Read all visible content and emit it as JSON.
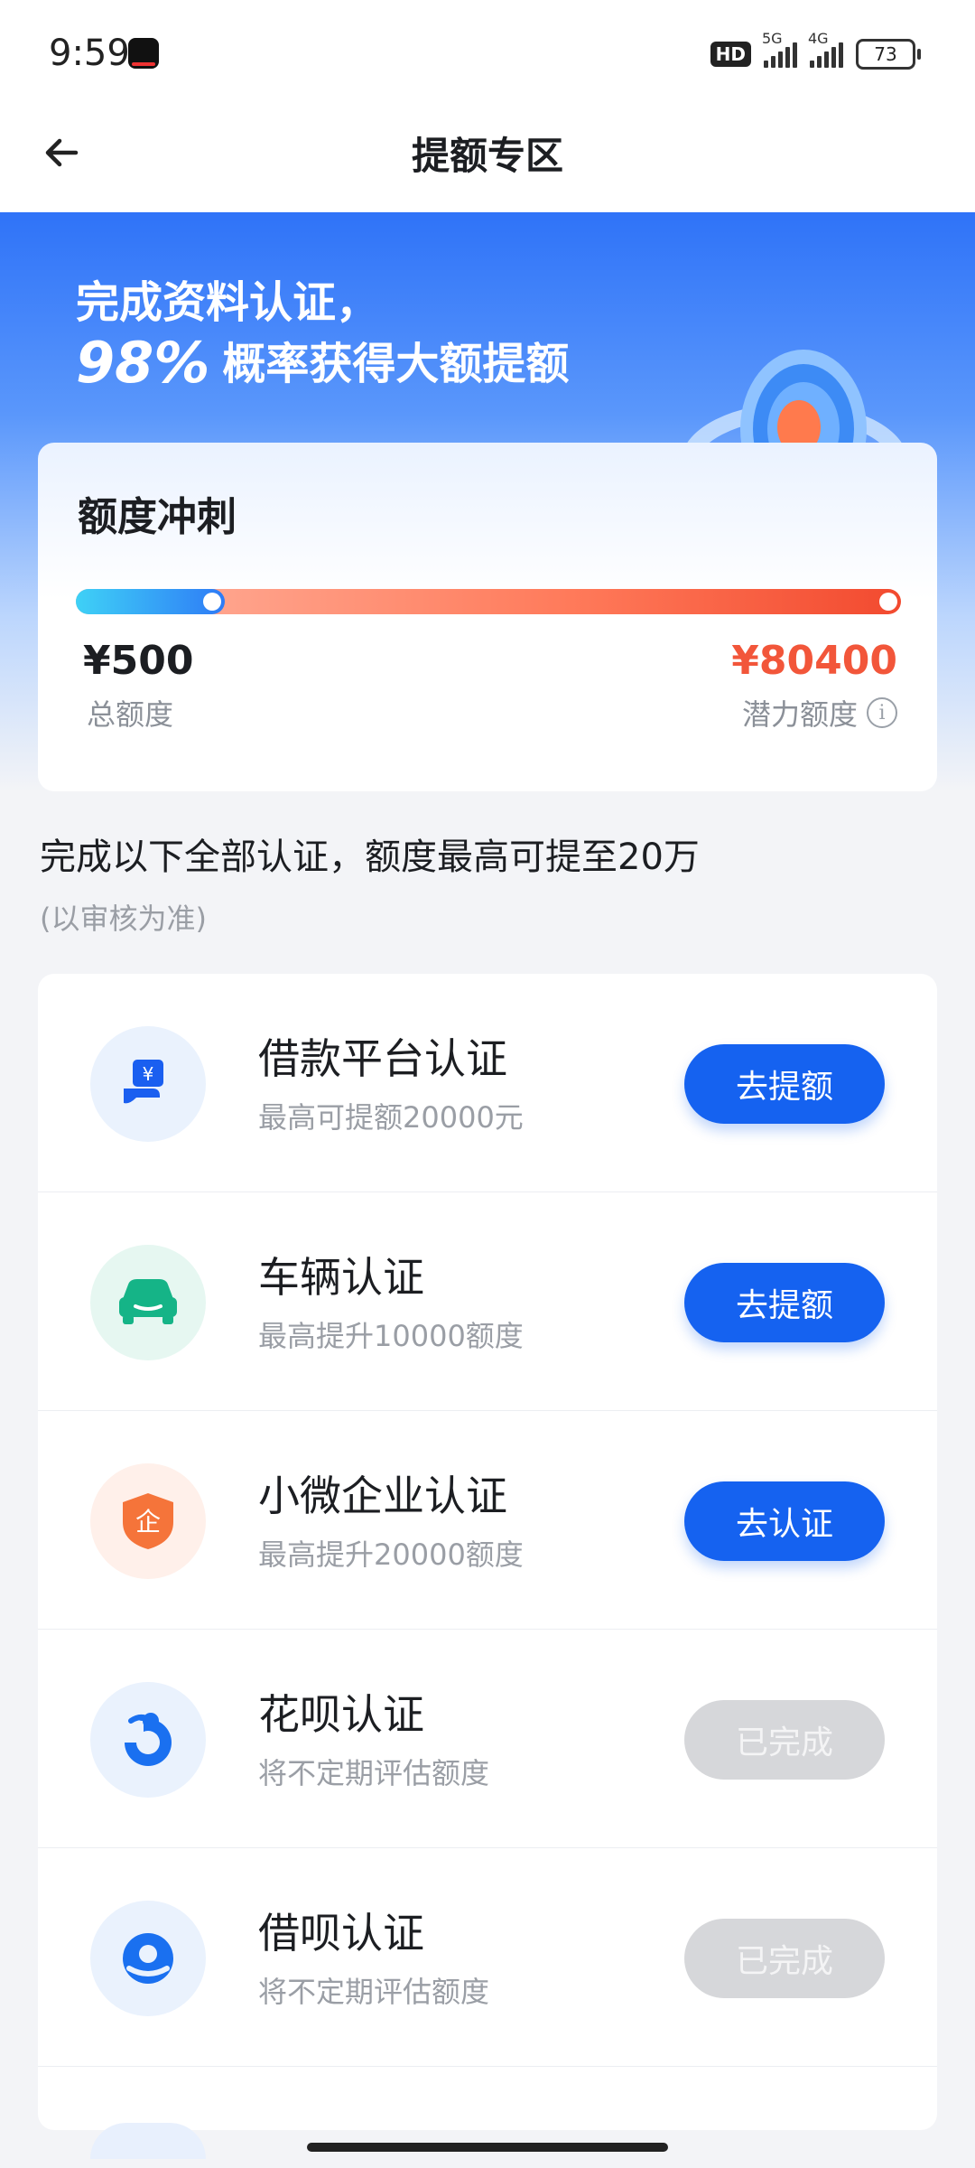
{
  "status_bar": {
    "time": "9:59",
    "hd_badge": "HD",
    "network_1": "5G",
    "network_2": "4G",
    "battery": "73"
  },
  "nav": {
    "title": "提额专区"
  },
  "hero": {
    "line1": "完成资料认证，",
    "percent": "98%",
    "line2": "概率获得大额提额"
  },
  "credit_card": {
    "title": "额度冲刺",
    "progress_fraction": 0.18,
    "total_amount": "¥500",
    "total_label": "总额度",
    "potential_amount": "¥80400",
    "potential_label": "潜力额度",
    "colors": {
      "accent": "#1562f0",
      "potential": "#f2563a"
    }
  },
  "section": {
    "heading": "完成以下全部认证，额度最高可提至20万",
    "note": "(以审核为准)"
  },
  "certifications": [
    {
      "name": "借款平台认证",
      "desc": "最高可提额20000元",
      "button": "去提额",
      "state": "active",
      "icon": "yuan-hand-icon"
    },
    {
      "name": "车辆认证",
      "desc": "最高提升10000额度",
      "button": "去提额",
      "state": "active",
      "icon": "car-icon"
    },
    {
      "name": "小微企业认证",
      "desc": "最高提升20000额度",
      "button": "去认证",
      "state": "active",
      "icon": "enterprise-shield-icon"
    },
    {
      "name": "花呗认证",
      "desc": "将不定期评估额度",
      "button": "已完成",
      "state": "done",
      "icon": "huabei-icon"
    },
    {
      "name": "借呗认证",
      "desc": "将不定期评估额度",
      "button": "已完成",
      "state": "done",
      "icon": "jiebei-icon"
    }
  ]
}
